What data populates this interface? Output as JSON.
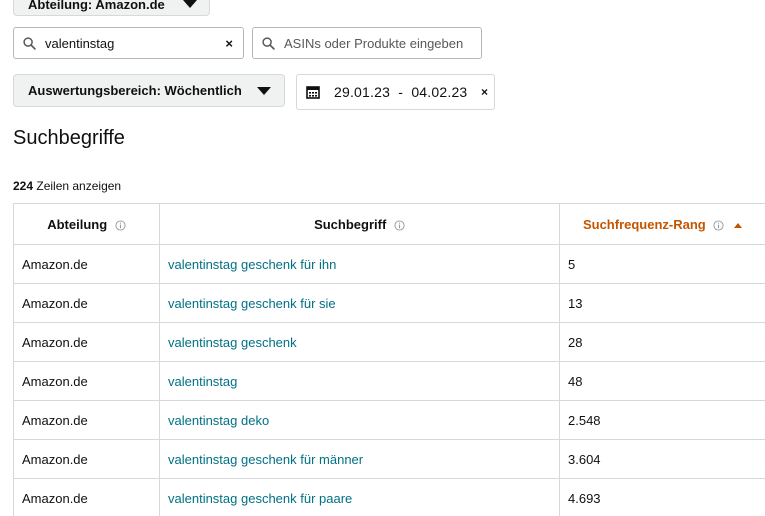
{
  "filters": {
    "department_button": "Abteilung: Amazon.de",
    "search_term_value": "valentinstag",
    "asin_placeholder": "ASINs oder Produkte eingeben",
    "range_button": "Auswertungsbereich: Wöchentlich",
    "date_range": "29.01.23  -  04.02.23",
    "clear_symbol": "×"
  },
  "section": {
    "title": "Suchbegriffe",
    "row_count": "224",
    "row_count_suffix": " Zeilen anzeigen"
  },
  "table": {
    "headers": {
      "department": "Abteilung",
      "search_term": "Suchbegriff",
      "rank": "Suchfrequenz-Rang"
    },
    "rows": [
      {
        "department": "Amazon.de",
        "term": "valentinstag geschenk für ihn",
        "rank": "5"
      },
      {
        "department": "Amazon.de",
        "term": "valentinstag geschenk für sie",
        "rank": "13"
      },
      {
        "department": "Amazon.de",
        "term": "valentinstag geschenk",
        "rank": "28"
      },
      {
        "department": "Amazon.de",
        "term": "valentinstag",
        "rank": "48"
      },
      {
        "department": "Amazon.de",
        "term": "valentinstag deko",
        "rank": "2.548"
      },
      {
        "department": "Amazon.de",
        "term": "valentinstag geschenk für männer",
        "rank": "3.604"
      },
      {
        "department": "Amazon.de",
        "term": "valentinstag geschenk für paare",
        "rank": "4.693"
      }
    ]
  },
  "colors": {
    "link": "#007185",
    "sort_active": "#c45500",
    "border": "#d5d9d9"
  },
  "icons": {
    "search": "search-icon",
    "calendar": "calendar-icon",
    "info": "info-icon",
    "dropdown": "chevron-down-icon",
    "sort": "sort-ascending-icon"
  }
}
